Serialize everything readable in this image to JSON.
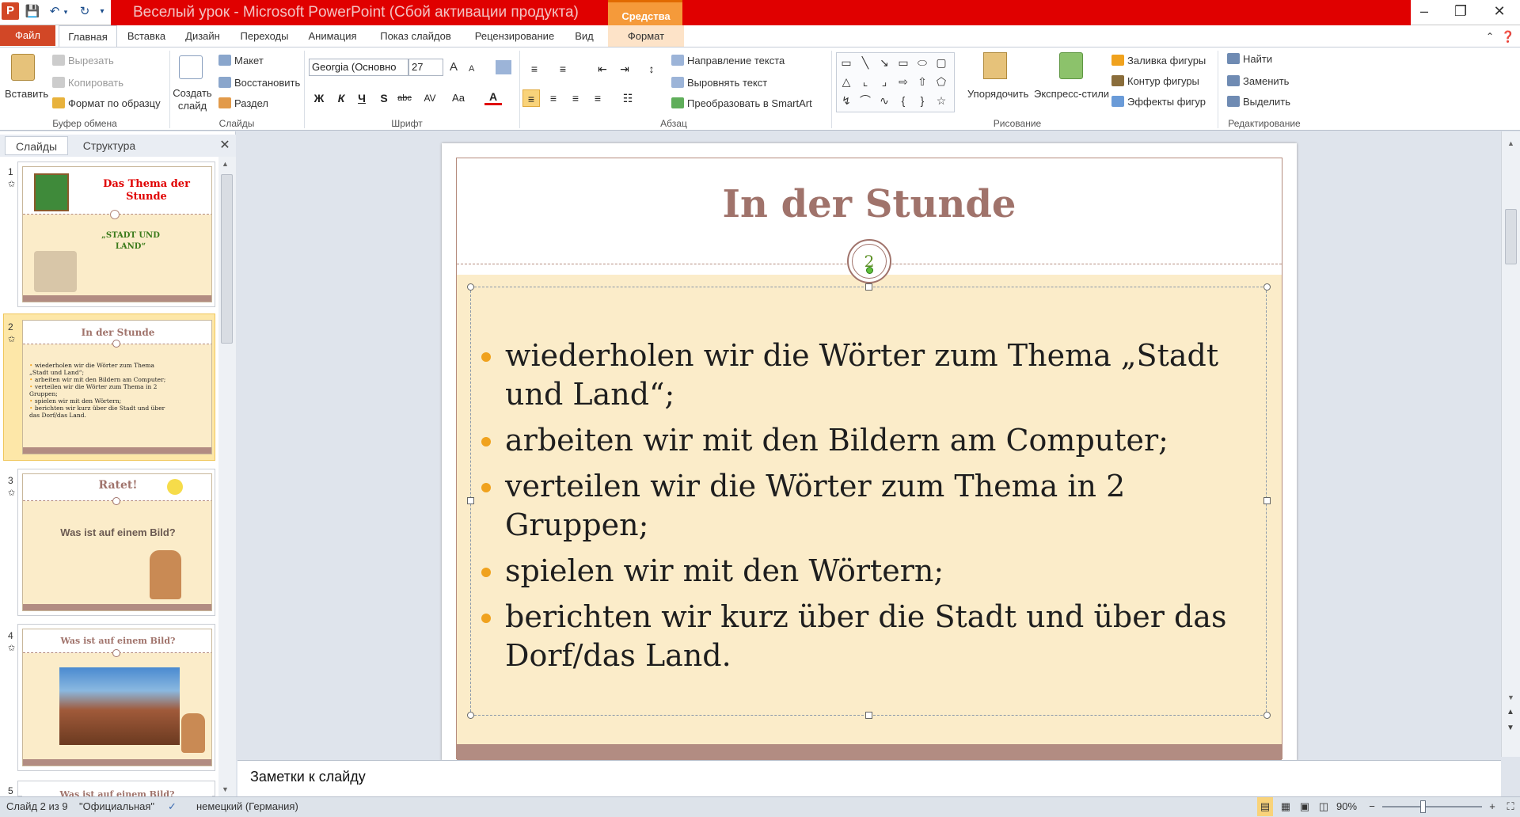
{
  "window": {
    "title": "Веселый урок - Microsoft PowerPoint (Сбой активации продукта)",
    "context_tool_title": "Средства рисования",
    "minimize": "–",
    "maximize": "❐",
    "close": "✕"
  },
  "quick_access": {
    "app_icon": "P",
    "save_icon": "save-icon",
    "undo_icon": "undo-icon",
    "redo_icon": "redo-icon"
  },
  "tabs": [
    "Файл",
    "Главная",
    "Вставка",
    "Дизайн",
    "Переходы",
    "Анимация",
    "Показ слайдов",
    "Рецензирование",
    "Вид",
    "Формат"
  ],
  "ribbon": {
    "clipboard": {
      "paste": "Вставить",
      "cut": "Вырезать",
      "copy": "Копировать",
      "format_painter": "Формат по образцу",
      "label": "Буфер обмена"
    },
    "slides": {
      "new_slide": "Создать слайд",
      "layout": "Макет",
      "reset": "Восстановить",
      "section": "Раздел",
      "label": "Слайды"
    },
    "font": {
      "name": "Georgia (Основно",
      "size": "27",
      "label": "Шрифт",
      "bold": "Ж",
      "italic": "К",
      "underline": "Ч",
      "shadow": "S",
      "strike": "abc",
      "spacing": "AV",
      "case": "Aa",
      "color": "A",
      "grow": "A",
      "shrink": "A"
    },
    "paragraph": {
      "text_direction": "Направление текста",
      "align_text": "Выровнять текст",
      "smartart": "Преобразовать в SmartArt",
      "label": "Абзац"
    },
    "drawing": {
      "arrange": "Упорядочить",
      "quick_styles": "Экспресс-стили",
      "fill": "Заливка фигуры",
      "outline": "Контур фигуры",
      "effects": "Эффекты фигур",
      "label": "Рисование"
    },
    "editing": {
      "find": "Найти",
      "replace": "Заменить",
      "select": "Выделить",
      "label": "Редактирование"
    }
  },
  "left_panel": {
    "tab_slides": "Слайды",
    "tab_outline": "Структура",
    "close": "✕",
    "slides": [
      {
        "num": "1",
        "title": "Das Thema der Stunde",
        "body": "„STADT UND LAND“"
      },
      {
        "num": "2",
        "title": "In der Stunde",
        "bullets": [
          "wiederholen wir die Wörter zum Thema „Stadt und Land“;",
          "arbeiten wir mit den Bildern am Computer;",
          "verteilen wir die Wörter zum Thema in 2 Gruppen;",
          "spielen wir mit den Wörtern;",
          "berichten wir kurz über die Stadt und über das Dorf/das Land."
        ]
      },
      {
        "num": "3",
        "title": "Ratet!",
        "body": "Was  ist auf einem Bild?"
      },
      {
        "num": "4",
        "title": "Was ist auf einem Bild?"
      },
      {
        "num": "5",
        "title": "Was ist auf einem Bild?"
      }
    ]
  },
  "slide": {
    "title": "In der Stunde",
    "badge": "2",
    "bullets": [
      "wiederholen wir die Wörter zum Thema „Stadt und Land“;",
      "arbeiten wir mit den Bildern am Computer;",
      "verteilen wir die Wörter zum Thema in 2 Gruppen;",
      "spielen wir mit den Wörtern;",
      "berichten wir kurz über die Stadt und über das Dorf/das Land."
    ],
    "colors": {
      "title": "#a0736b",
      "bullet": "#f0a21e",
      "background": "#fbecc9",
      "bar": "#b28c82"
    }
  },
  "notes": {
    "placeholder": "Заметки к слайду"
  },
  "status": {
    "slide_info": "Слайд 2 из 9",
    "theme": "\"Официальная\"",
    "language": "немецкий (Германия)",
    "zoom": "90%",
    "zoom_out": "−",
    "zoom_in": "+"
  }
}
